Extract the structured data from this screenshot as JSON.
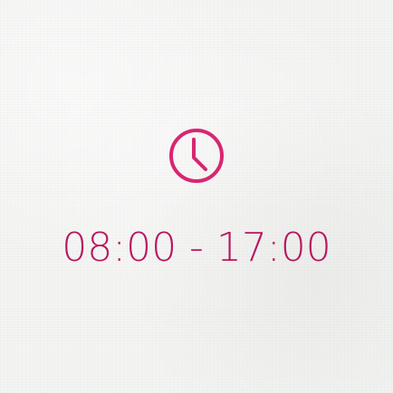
{
  "icon": {
    "name": "clock-icon",
    "color": "#d82671"
  },
  "hours": {
    "text": "08:00 - 17:00",
    "color": "#b8165e"
  },
  "background_color": "#f4f4f3"
}
